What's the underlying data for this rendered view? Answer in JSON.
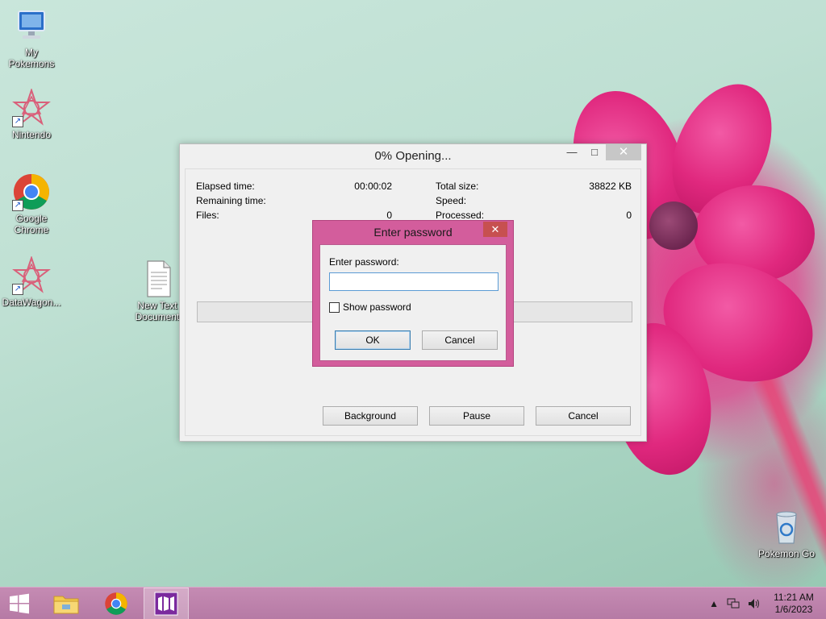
{
  "desktop": {
    "icons": [
      {
        "label": "My Pokemons",
        "icon": "computer-icon"
      },
      {
        "label": "Nintendo",
        "icon": "star-app-icon"
      },
      {
        "label": "Google Chrome",
        "icon": "chrome-icon"
      },
      {
        "label": "DataWagon...",
        "icon": "star-app-icon"
      },
      {
        "label": "New Text Document",
        "icon": "text-document-icon"
      },
      {
        "label": "Pokemon Go",
        "icon": "recycle-bin-icon"
      }
    ]
  },
  "progress_window": {
    "title": "0% Opening...",
    "elapsed_label": "Elapsed time:",
    "elapsed_value": "00:00:02",
    "remaining_label": "Remaining time:",
    "files_label": "Files:",
    "files_value": "0",
    "total_size_label": "Total size:",
    "total_size_value": "38822 KB",
    "speed_label": "Speed:",
    "processed_label": "Processed:",
    "processed_value": "0",
    "progress_fraction": 0,
    "buttons": {
      "background": "Background",
      "pause": "Pause",
      "cancel": "Cancel"
    }
  },
  "password_dialog": {
    "title": "Enter password",
    "field_label": "Enter password:",
    "field_value": "",
    "show_password_label": "Show password",
    "show_password_checked": false,
    "ok_label": "OK",
    "cancel_label": "Cancel"
  },
  "taskbar": {
    "time": "11:21 AM",
    "date": "1/6/2023"
  },
  "colors": {
    "dialog_frame": "#d35d9c",
    "taskbar": "#c58bb3"
  }
}
